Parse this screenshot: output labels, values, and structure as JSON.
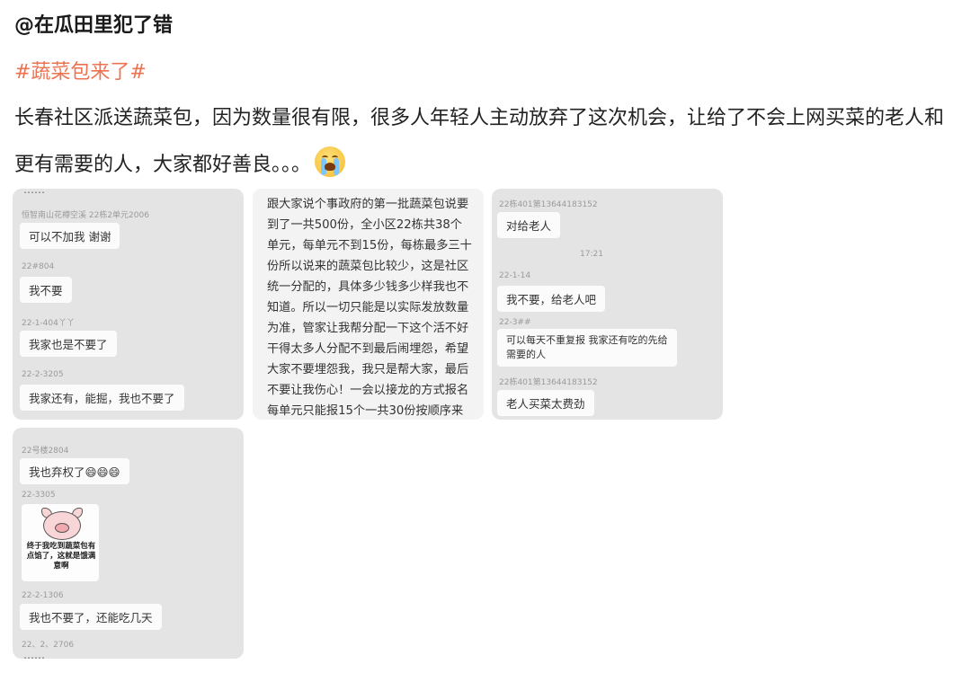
{
  "post": {
    "author": "@在瓜田里犯了错",
    "hashtag": "#蔬菜包来了#",
    "body": "长春社区派送蔬菜包，因为数量很有限，很多人年轻人主动放弃了这次机会，让给了不会上网买菜的老人和更有需要的人，大家都好善良。。。",
    "emoji": "crying-face-icon"
  },
  "images": {
    "img1": {
      "partial_top": "……",
      "meta1": "恒智南山花樽空溪 22栋2单元2006",
      "msg1": "可以不加我 谢谢",
      "meta2": "22#804",
      "msg2": "我不要",
      "meta3": "22-1-404丫丫",
      "msg3": "我家也是不要了",
      "meta4": "22-2-3205",
      "msg4": "我家还有，能掘，我也不要了"
    },
    "img2": {
      "note": "跟大家说个事政府的第一批蔬菜包说要到了一共500份，全小区22栋共38个单元，每单元不到15份，每栋最多三十份所以说来的蔬菜包比较少，这是社区统一分配的，具体多少钱多少样我也不知道。所以一切只能是以实际发放数量为准，管家让我帮分配一下这个活不好干得太多人分配不到最后闹埋怨，希望大家不要埋怨我，我只是帮大家，最后不要让我伤心！一会以接龙的方式报名每单元只能报15个一共30份按顺序来依次领取，谢"
    },
    "img3": {
      "meta1": "22栋401第13644183152",
      "msg1": "对给老人",
      "time": "17:21",
      "meta2": "22-1-14",
      "msg2": "我不要，给老人吧",
      "meta3": "22-3##",
      "msg3": "可以每天不重复报 我家还有吃的先给需要的人",
      "meta4": "22栋401第13644183152",
      "msg4": "老人买菜太费劲"
    },
    "img4": {
      "meta1": "22号楼2804",
      "msg1": "我也弃权了😄😄😄",
      "meta2": "22-3305",
      "sticker_text": "终于我吃到蔬菜包有点馅了，这就是饿满意啊",
      "meta3": "22-2-1306",
      "msg3": "我也不要了，还能吃几天",
      "meta4": "22、2、2706",
      "partial_bottom": "……"
    }
  }
}
